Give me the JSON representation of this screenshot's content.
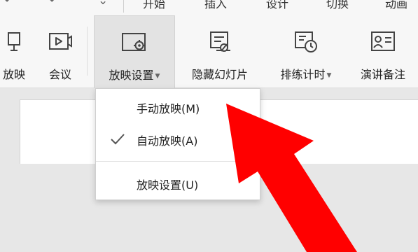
{
  "topbar": {
    "quick_access": [
      "↶",
      "↷",
      "⌄"
    ],
    "tabs": [
      "开始",
      "插入",
      "设计",
      "切换",
      "动画"
    ]
  },
  "ribbon": {
    "buttons": [
      {
        "label": "放映",
        "icon": "slideshow-icon"
      },
      {
        "label": "会议",
        "icon": "video-meeting-icon"
      },
      {
        "label": "放映设置",
        "icon": "slideshow-settings-icon",
        "has_caret": true,
        "active": true
      },
      {
        "label": "隐藏幻灯片",
        "icon": "hide-slide-icon"
      },
      {
        "label": "排练计时",
        "icon": "rehearse-timing-icon",
        "has_caret": true
      },
      {
        "label": "演讲备注",
        "icon": "speaker-notes-icon"
      }
    ]
  },
  "dropdown": {
    "items": [
      {
        "label": "手动放映(M)",
        "checked": false
      },
      {
        "label": "自动放映(A)",
        "checked": true
      },
      {
        "label": "放映设置(U)",
        "checked": false
      }
    ]
  },
  "colors": {
    "arrow": "#ff0000",
    "ribbon_bg": "#f7f7f7",
    "active_bg": "#e3e3e3",
    "menu_bg": "#ffffff"
  }
}
